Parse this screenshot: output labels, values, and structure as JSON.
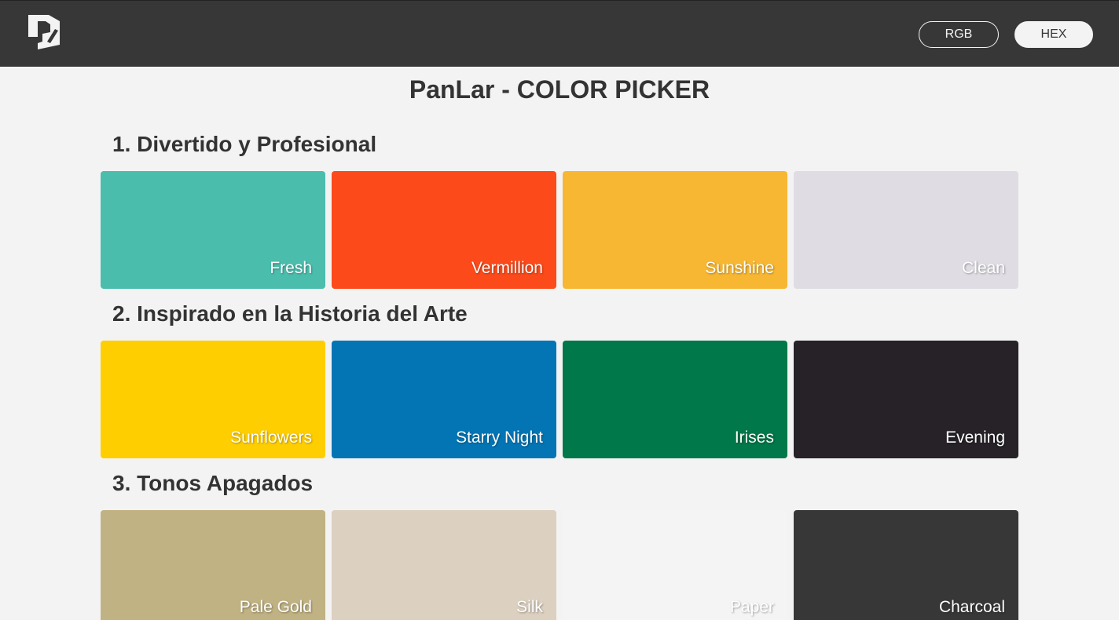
{
  "header": {
    "logo_icon": "panlar-logo-icon",
    "buttons": {
      "rgb": "RGB",
      "hex": "HEX"
    },
    "bar_color": "#373737"
  },
  "page": {
    "title": "PanLar - COLOR PICKER"
  },
  "sections": [
    {
      "title": "1. Divertido y Profesional",
      "colors": [
        {
          "name": "Fresh",
          "hex": "#4BBDAD"
        },
        {
          "name": "Vermillion",
          "hex": "#FC4A1A"
        },
        {
          "name": "Sunshine",
          "hex": "#F7B733"
        },
        {
          "name": "Clean",
          "hex": "#DFDCE3"
        }
      ]
    },
    {
      "title": "2. Inspirado en la Historia del Arte",
      "colors": [
        {
          "name": "Sunflowers",
          "hex": "#FFCE00"
        },
        {
          "name": "Starry Night",
          "hex": "#0375B4"
        },
        {
          "name": "Irises",
          "hex": "#007849"
        },
        {
          "name": "Evening",
          "hex": "#262228"
        }
      ]
    },
    {
      "title": "3. Tonos Apagados",
      "colors": [
        {
          "name": "Pale Gold",
          "hex": "#C0B283"
        },
        {
          "name": "Silk",
          "hex": "#DCD0C0"
        },
        {
          "name": "Paper",
          "hex": "#F4F4F4"
        },
        {
          "name": "Charcoal",
          "hex": "#373737"
        }
      ]
    }
  ]
}
